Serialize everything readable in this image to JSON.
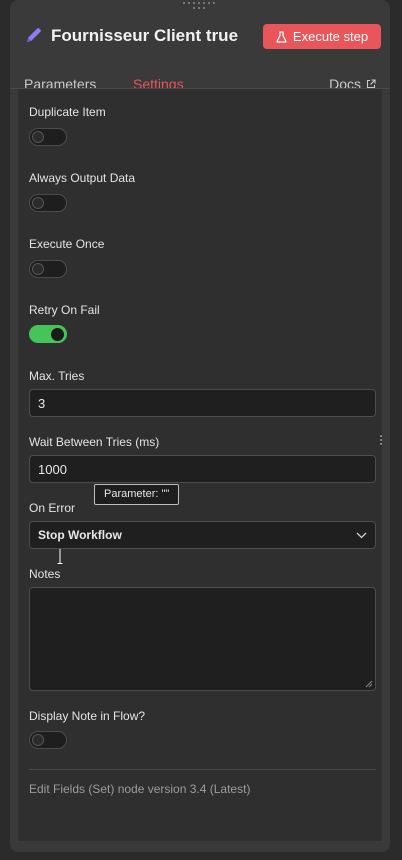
{
  "header": {
    "title": "Fournisseur Client true",
    "execute_label": "Execute step",
    "pencil_icon": "pencil-icon",
    "flask_icon": "flask-icon"
  },
  "tabs": {
    "parameters": "Parameters",
    "settings": "Settings",
    "docs": "Docs",
    "active": "Settings"
  },
  "settings": {
    "duplicate_item": {
      "label": "Duplicate Item",
      "enabled": false
    },
    "always_output_data": {
      "label": "Always Output Data",
      "enabled": false
    },
    "execute_once": {
      "label": "Execute Once",
      "enabled": false
    },
    "retry_on_fail": {
      "label": "Retry On Fail",
      "enabled": true
    },
    "max_tries": {
      "label": "Max. Tries",
      "value": "3"
    },
    "wait_between_tries": {
      "label": "Wait Between Tries (ms)",
      "value": "1000"
    },
    "on_error": {
      "label": "On Error",
      "value": "Stop Workflow"
    },
    "notes": {
      "label": "Notes",
      "value": ""
    },
    "display_note": {
      "label": "Display Note in Flow?",
      "enabled": false
    }
  },
  "tooltip": {
    "text": "Parameter: \"\""
  },
  "footer": {
    "text": "Edit Fields (Set) node version 3.4 (Latest)"
  },
  "colors": {
    "accent": "#e8555a",
    "toggle_on": "#45c45a",
    "panel_bg": "#3a3a3b",
    "content_bg": "#2f2f30"
  }
}
